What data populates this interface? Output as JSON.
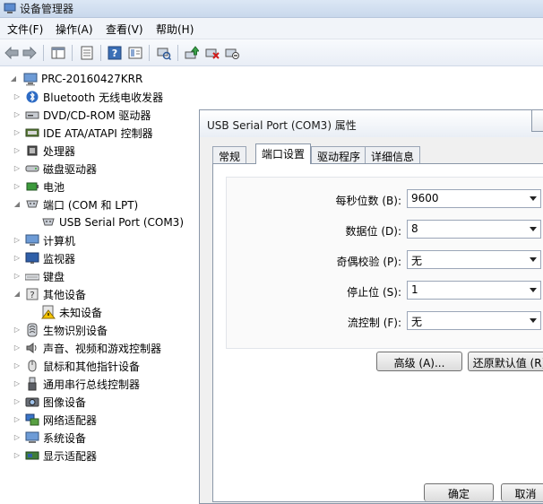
{
  "window": {
    "title": "设备管理器"
  },
  "menu": [
    "文件(F)",
    "操作(A)",
    "查看(V)",
    "帮助(H)"
  ],
  "tree": {
    "root": "PRC-20160427KRR",
    "items": [
      {
        "label": "Bluetooth 无线电收发器",
        "icon": "bluetooth-icon",
        "expanded": false
      },
      {
        "label": "DVD/CD-ROM 驱动器",
        "icon": "dvd-drive-icon",
        "expanded": false
      },
      {
        "label": "IDE ATA/ATAPI 控制器",
        "icon": "ide-controller-icon",
        "expanded": false
      },
      {
        "label": "处理器",
        "icon": "processor-icon",
        "expanded": false
      },
      {
        "label": "磁盘驱动器",
        "icon": "disk-drive-icon",
        "expanded": false
      },
      {
        "label": "电池",
        "icon": "battery-icon",
        "expanded": false
      },
      {
        "label": "端口 (COM 和 LPT)",
        "icon": "port-icon",
        "expanded": true
      },
      {
        "label": "USB Serial Port (COM3)",
        "icon": "serial-port-icon",
        "child": true
      },
      {
        "label": "计算机",
        "icon": "computer-icon",
        "expanded": false
      },
      {
        "label": "监视器",
        "icon": "monitor-icon",
        "expanded": false
      },
      {
        "label": "键盘",
        "icon": "keyboard-icon",
        "expanded": false
      },
      {
        "label": "其他设备",
        "icon": "other-devices-icon",
        "expanded": true
      },
      {
        "label": "未知设备",
        "icon": "unknown-device-warning-icon",
        "child": true
      },
      {
        "label": "生物识别设备",
        "icon": "biometric-icon",
        "expanded": false
      },
      {
        "label": "声音、视频和游戏控制器",
        "icon": "sound-icon",
        "expanded": false
      },
      {
        "label": "鼠标和其他指针设备",
        "icon": "mouse-icon",
        "expanded": false
      },
      {
        "label": "通用串行总线控制器",
        "icon": "usb-controller-icon",
        "expanded": false
      },
      {
        "label": "图像设备",
        "icon": "imaging-device-icon",
        "expanded": false
      },
      {
        "label": "网络适配器",
        "icon": "network-adapter-icon",
        "expanded": false
      },
      {
        "label": "系统设备",
        "icon": "system-device-icon",
        "expanded": false
      },
      {
        "label": "显示适配器",
        "icon": "display-adapter-icon",
        "expanded": false
      }
    ]
  },
  "dialog": {
    "title": "USB Serial Port (COM3) 属性",
    "tabs": [
      "常规",
      "端口设置",
      "驱动程序",
      "详细信息"
    ],
    "active_tab": "端口设置",
    "fields": [
      {
        "label": "每秒位数 (B):",
        "value": "9600"
      },
      {
        "label": "数据位 (D):",
        "value": "8"
      },
      {
        "label": "奇偶校验 (P):",
        "value": "无"
      },
      {
        "label": "停止位 (S):",
        "value": "1"
      },
      {
        "label": "流控制 (F):",
        "value": "无"
      }
    ],
    "buttons": {
      "advanced": "高级 (A)...",
      "restore": "还原默认值 (R)"
    },
    "footer": {
      "ok": "确定",
      "cancel": "取消"
    }
  },
  "colors": {
    "accent": "#3b6fb6",
    "warning": "#f5c400"
  }
}
